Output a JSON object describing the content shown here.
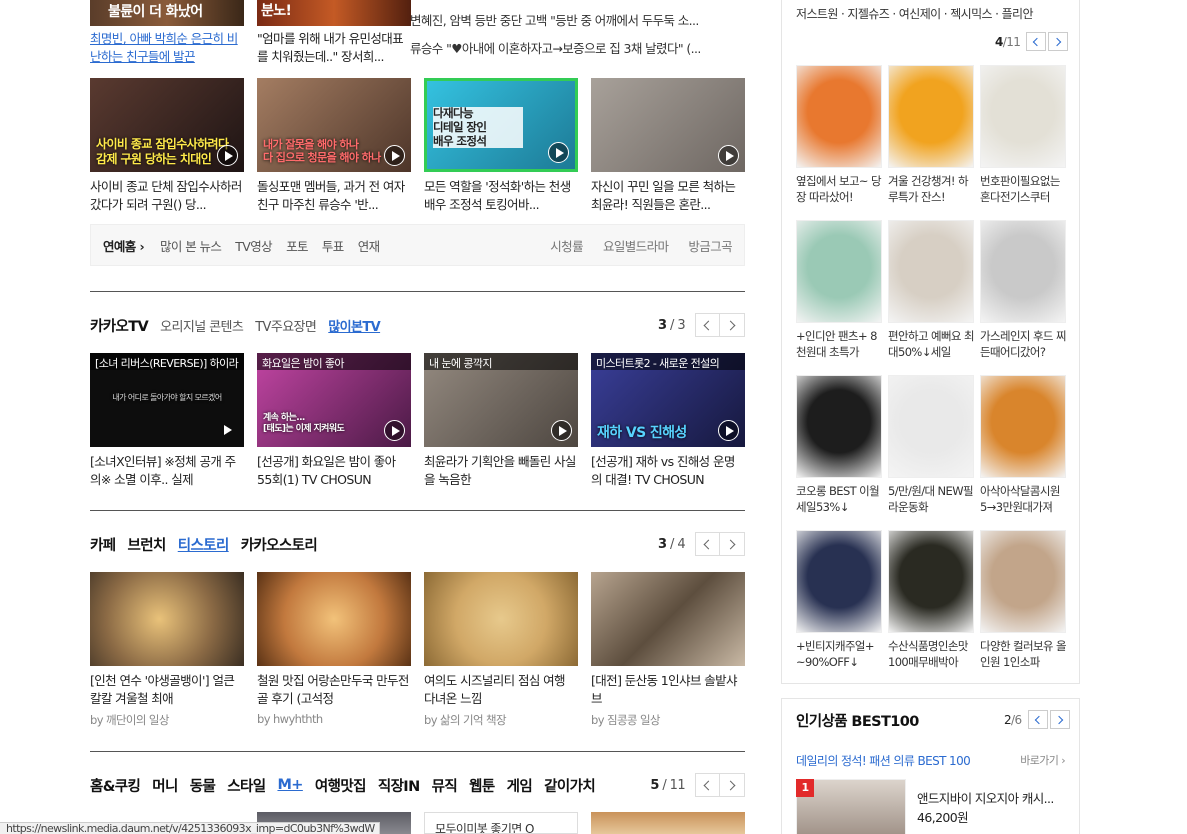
{
  "top_row": {
    "thumb1_caption": "불륜이 더 화났어",
    "thumb2_caption": "분노!",
    "link1": "최명빈, 아빠 박희순 은근히 비난하는 친구들에 발끈",
    "link2": "\"엄마를 위해 내가 유민성대표를 치워줬는데..\" 장서희...",
    "lines": [
      "변혜진, 암벽 등반 중단 고백 \"등반 중 어깨에서 두두둑 소...",
      "류승수 \"♥아내에 이혼하자고→보증으로 집 3채 날렸다\" (..."
    ]
  },
  "ent_row": [
    {
      "caption": "사이비 종교 잠입수사하려다\n감제 구원 당하는 치대인",
      "title": "사이비 종교 단체 잠입수사하러 갔다가 되려 구원() 당...",
      "bg": "#3b2a25"
    },
    {
      "caption": "내가 잘못을 해야 하나\n다 집으로 청문을 해야 하나",
      "title": "돌싱포맨 멤버들, 과거 전 여자친구 마주친 류승수 '반...",
      "bg": "#7a5a4a"
    },
    {
      "caption": "다재다능\n디테일 장인\n배우 조정석",
      "title": "모든 역할을 '정석화'하는 천생 배우 조정석 토킹어바...",
      "bg": "#2fa7c9"
    },
    {
      "caption": "",
      "title": "자신이 꾸민 일을 모른 척하는 최윤라! 직원들은 혼란...",
      "bg": "#8d8782"
    }
  ],
  "ent_nav": {
    "first": "연예홈",
    "left": [
      "많이 본 뉴스",
      "TV영상",
      "포토",
      "투표",
      "연재"
    ],
    "right": [
      "시청률",
      "요일별드라마",
      "방금그곡"
    ]
  },
  "kakaotv": {
    "tabs": [
      "카카오TV",
      "오리지널 콘텐츠",
      "TV주요장면",
      "많이본TV"
    ],
    "page_current": "3",
    "page_total": "3",
    "items": [
      {
        "tag": "[소녀 리버스(REVERSE)] 하이라",
        "overlay": "내가 어디로 돌아가야 할지 모르겠어",
        "title": "[소녀X인터뷰] ※정체 공개 주의※ 소멸 이후.. 실제",
        "bg": "#0d0d0d"
      },
      {
        "tag": "화요일은 밤이 좋아",
        "overlay": "계속 하는...\n[태도]는 이제 지켜워도",
        "title": "[선공개] 화요일은 밤이 좋아 55회(1) TV CHOSUN",
        "bg": "#7e2f6e"
      },
      {
        "tag": "내 눈에 콩깍지",
        "overlay": "",
        "title": "최윤라가 기획안을 빼돌린 사실을 녹음한",
        "bg": "#6b625a"
      },
      {
        "tag": "미스터트롯2 - 새로운 전설의",
        "overlay": "재하 VS 진해성",
        "title": "[선공개] 재하 vs 진해성 운명의 대결! TV CHOSUN",
        "bg": "#2b2f7a"
      }
    ]
  },
  "cafe": {
    "tabs": [
      "카페",
      "브런치",
      "티스토리",
      "카카오스토리"
    ],
    "page_current": "3",
    "page_total": "4",
    "items": [
      {
        "title": "[인천 연수 '야생골뱅이'] 얼큰 칼칼 겨울철 최애",
        "src": "by 깨단이의 일상",
        "bg": "#8b6a45"
      },
      {
        "title": "철원 맛집 어랑손만두국 만두전골 후기 (고석정",
        "src": "by hwyhthth",
        "bg": "#c2793e"
      },
      {
        "title": "여의도 시즈널리티 점심 여행 다녀온 느낌",
        "src": "by 삶의 기억 책장",
        "bg": "#d1a867"
      },
      {
        "title": "[대전] 둔산동 1인샤브 솔밭샤브",
        "src": "by 짐콩콩 일상",
        "bg": "#5d4e3e"
      }
    ]
  },
  "home": {
    "tabs": [
      "홈&쿠킹",
      "머니",
      "동물",
      "스타일",
      "M+",
      "여행맛집",
      "직장IN",
      "뮤직",
      "웹툰",
      "게임",
      "같이가치"
    ],
    "page_current": "5",
    "page_total": "11",
    "peek_text": "모두이미봇 좋기면 O"
  },
  "shopping": {
    "brands": "저스트원 · 지젤슈즈 · 여신제이 · 젝시믹스 · 플리안",
    "page_current": "4",
    "page_total": "/11",
    "products": [
      {
        "name": "옆집에서 보고~ 당장 따라샀어!",
        "bg": "#e8782f"
      },
      {
        "name": "겨울 건강챙겨! 하루특가 잔스!",
        "bg": "#f1a31f"
      },
      {
        "name": "번호판이필요없는 혼다전기스쿠터",
        "bg": "#e3e0d6"
      },
      {
        "name": "+인디안 팬츠+ 8천원대 초특가",
        "bg": "#9ac9b5"
      },
      {
        "name": "편안하고 예뻐요 최대50%↓세일",
        "bg": "#d7cfc4"
      },
      {
        "name": "가스레인지 후드 찌든때어디갔어?",
        "bg": "#c9c9c9"
      },
      {
        "name": "코오롱 BEST 이월세일53%↓",
        "bg": "#1d1d1d"
      },
      {
        "name": "5/만/원/대 NEW필라운동화",
        "bg": "#e9e9e9"
      },
      {
        "name": "아삭아삭달콤시원 5→3만원대가져",
        "bg": "#d9852c"
      },
      {
        "name": "+빈티지캐주얼+ ~90%OFF↓",
        "bg": "#283152"
      },
      {
        "name": "수산식품명인손맛 100매무배박아",
        "bg": "#2a2a22"
      },
      {
        "name": "다양한 컬러보유 올인원 1인소파",
        "bg": "#c2a58a"
      }
    ]
  },
  "best100": {
    "title": "인기상품 BEST100",
    "page_current": "2",
    "page_total": "/6",
    "link": "데일리의 정석! 패션 의류 BEST 100",
    "more": "바로가기 ›",
    "rank": "1",
    "item_name": "앤드지바이 지오지아 캐시...",
    "item_price": "46,200원"
  },
  "status_url": "https://newslink.media.daum.net/v/4251336093x_imp=dC0ub3Nf%3wdW",
  "colors": {
    "link_blue": "#2b6bd0",
    "rank_red": "#e22a2a"
  }
}
